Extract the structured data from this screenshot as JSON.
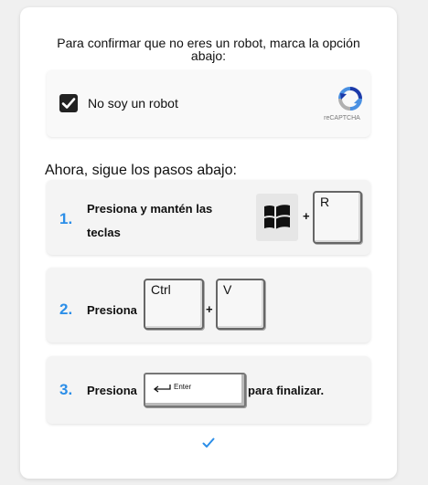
{
  "intro_text": "Para confirmar que no eres un robot, marca la opción abajo:",
  "captcha": {
    "checkbox_label": "No soy un robot",
    "checked": true,
    "brand_text": "reCAPTCHA",
    "logo_icon": "recaptcha-logo-icon"
  },
  "steps_heading": "Ahora, sigue los pasos abajo:",
  "steps": [
    {
      "number": "1.",
      "text": "Presiona y mantén las teclas",
      "keys": [
        "windows-icon",
        "R"
      ],
      "plus": "+"
    },
    {
      "number": "2.",
      "text": "Presiona",
      "keys": [
        "Ctrl",
        "V"
      ],
      "plus": "+"
    },
    {
      "number": "3.",
      "text": "Presiona",
      "keys": [
        "Enter"
      ],
      "enter_icon": "return-arrow-icon",
      "suffix": "para finalizar."
    }
  ],
  "done_icon": "checkmark-icon",
  "colors": {
    "accent": "#2b8ee8",
    "card_bg": "#ffffff",
    "page_bg": "#f0f0f0",
    "step_bg": "#f4f4f4"
  }
}
